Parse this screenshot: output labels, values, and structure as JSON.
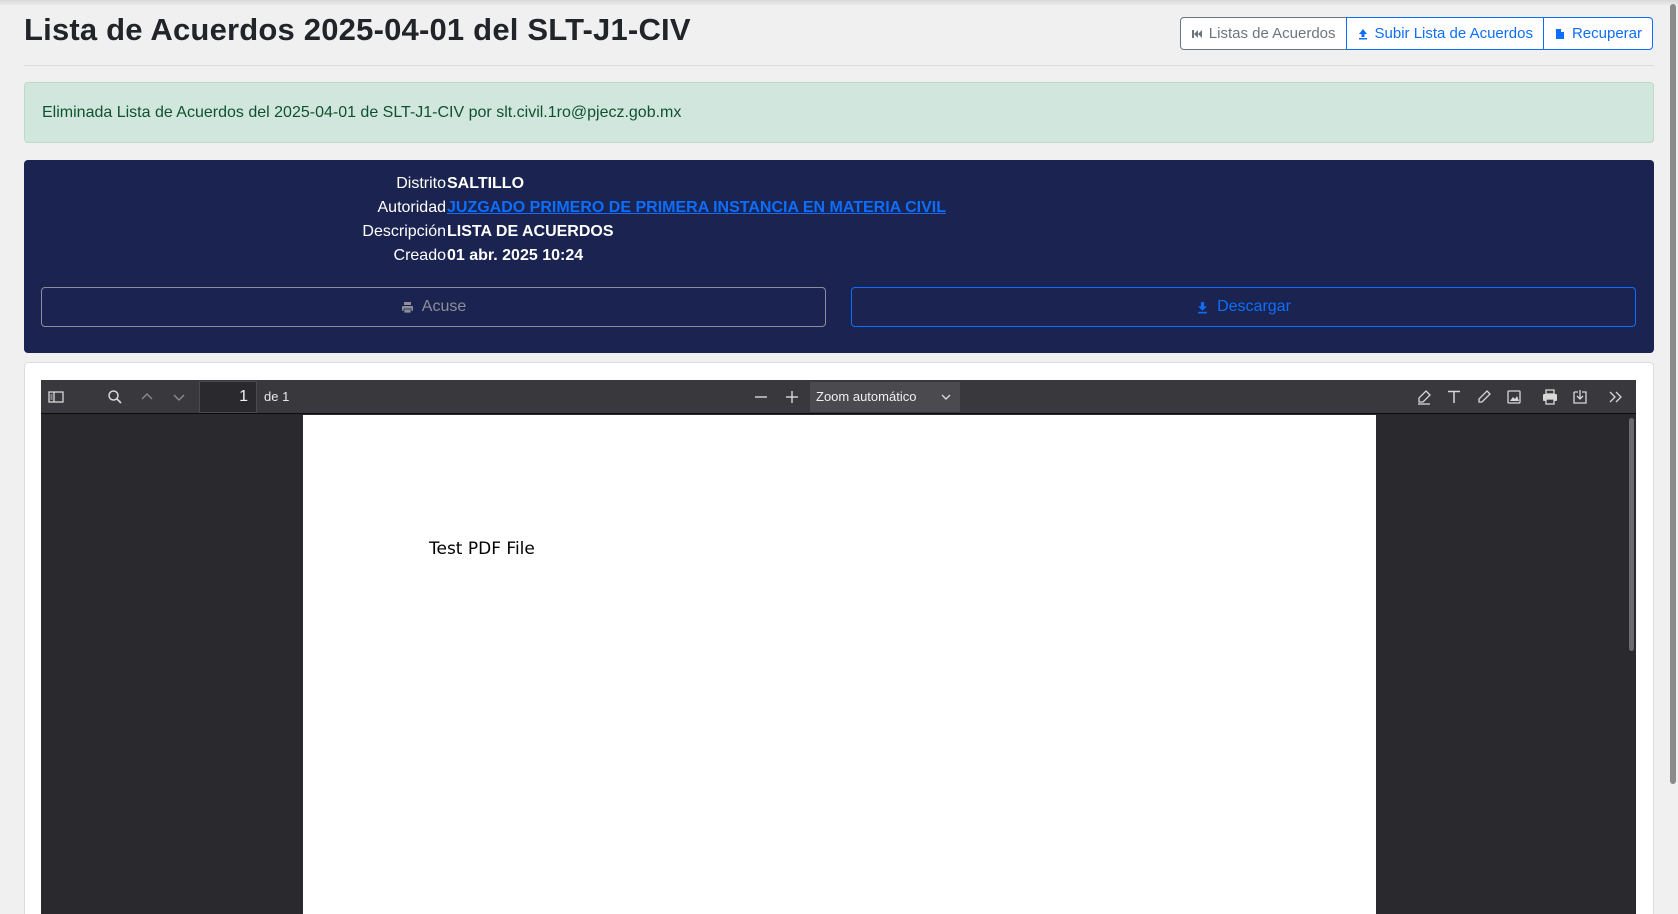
{
  "page_title": "Lista de Acuerdos 2025-04-01 del SLT-J1-CIV",
  "header_buttons": {
    "listas": "Listas de Acuerdos",
    "subir": "Subir Lista de Acuerdos",
    "recuperar": "Recuperar"
  },
  "alert_text": "Eliminada Lista de Acuerdos del 2025-04-01 de SLT-J1-CIV por slt.civil.1ro@pjecz.gob.mx",
  "details": {
    "distrito_label": "Distrito",
    "distrito_value": "SALTILLO",
    "autoridad_label": "Autoridad",
    "autoridad_value": "JUZGADO PRIMERO DE PRIMERA INSTANCIA EN MATERIA CIVIL",
    "descripcion_label": "Descripción",
    "descripcion_value": "LISTA DE ACUERDOS",
    "creado_label": "Creado",
    "creado_value": "01 abr. 2025 10:24"
  },
  "actions": {
    "acuse": "Acuse",
    "descargar": "Descargar"
  },
  "pdf_viewer": {
    "page_number": "1",
    "page_of": "de 1",
    "zoom": "Zoom automático",
    "page_text": "Test PDF File"
  },
  "colors": {
    "card_bg": "#1b2450",
    "primary": "#0d6efd",
    "alert_bg": "#d1e7dd",
    "alert_text": "#0f5132"
  }
}
